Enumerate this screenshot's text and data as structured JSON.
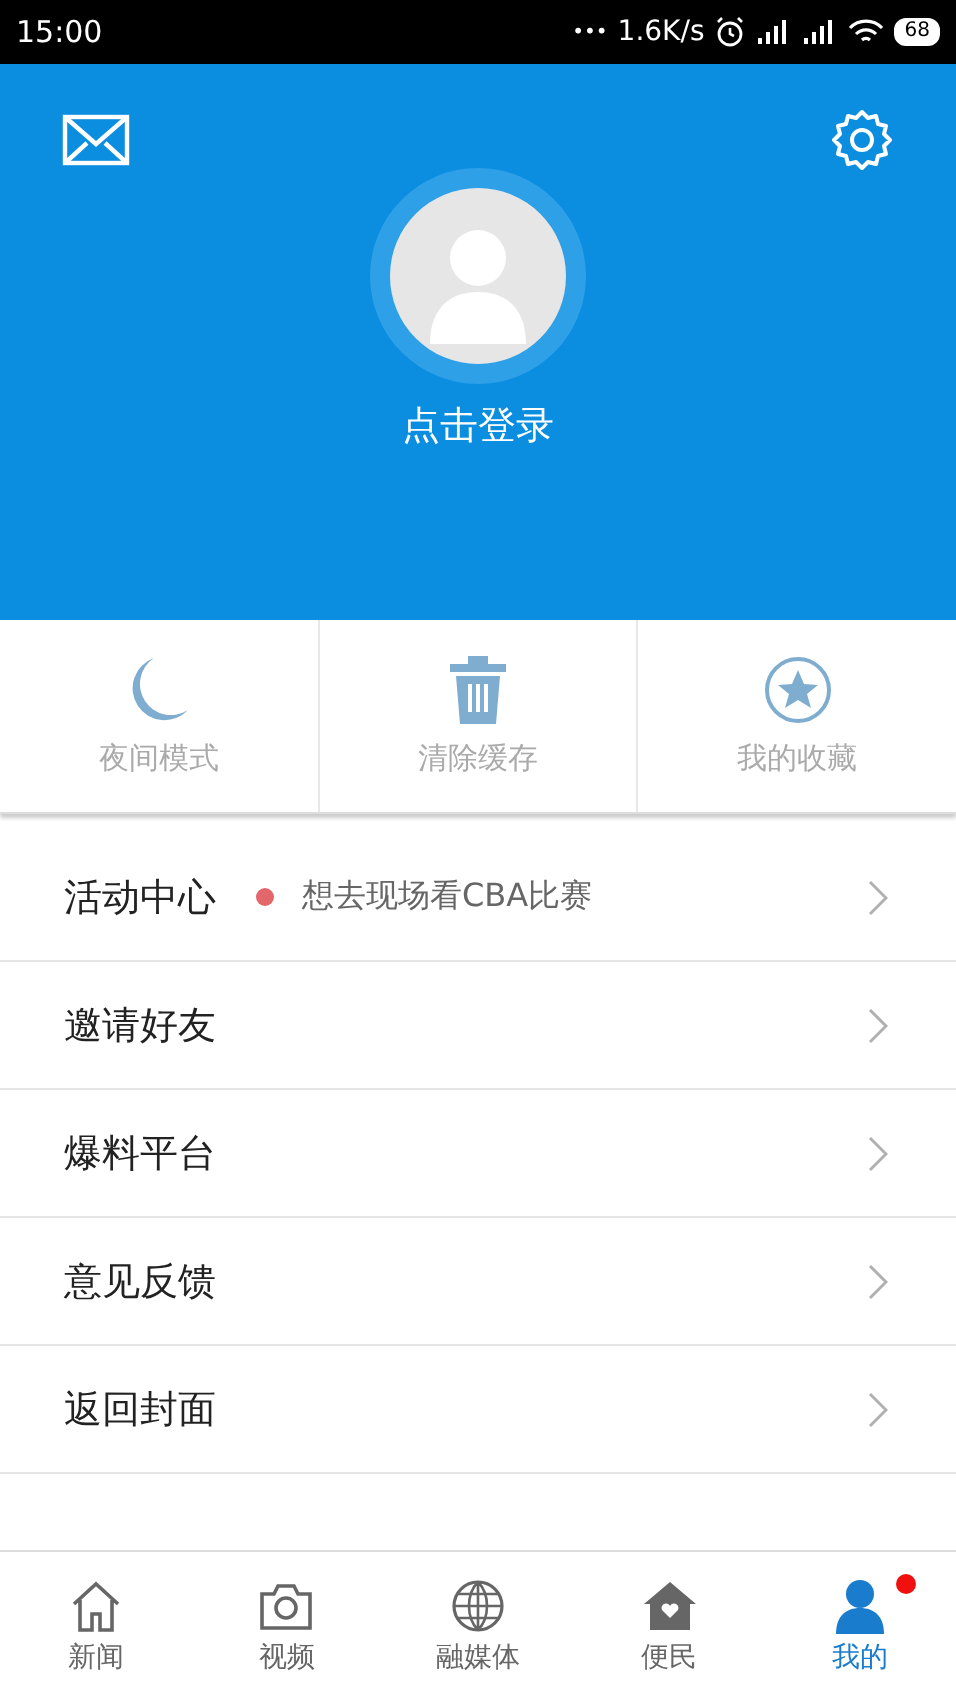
{
  "status_bar": {
    "time": "15:00",
    "dots": "•••",
    "speed": "1.6K/s",
    "battery": "68"
  },
  "header": {
    "login_label": "点击登录"
  },
  "quick_actions": [
    {
      "kind": "moon",
      "label": "夜间模式"
    },
    {
      "kind": "trash",
      "label": "清除缓存"
    },
    {
      "kind": "star",
      "label": "我的收藏"
    }
  ],
  "menu": [
    {
      "label": "活动中心",
      "note": "想去现场看CBA比赛"
    },
    {
      "label": "邀请好友"
    },
    {
      "label": "爆料平台"
    },
    {
      "label": "意见反馈"
    },
    {
      "label": "返回封面"
    }
  ],
  "nav": [
    {
      "kind": "home",
      "label": "新闻",
      "selected": false,
      "badge": false
    },
    {
      "kind": "camera",
      "label": "视频",
      "selected": false,
      "badge": false
    },
    {
      "kind": "globe",
      "label": "融媒体",
      "selected": false,
      "badge": false
    },
    {
      "kind": "house",
      "label": "便民",
      "selected": false,
      "badge": false
    },
    {
      "kind": "person",
      "label": "我的",
      "selected": true,
      "badge": true
    }
  ]
}
